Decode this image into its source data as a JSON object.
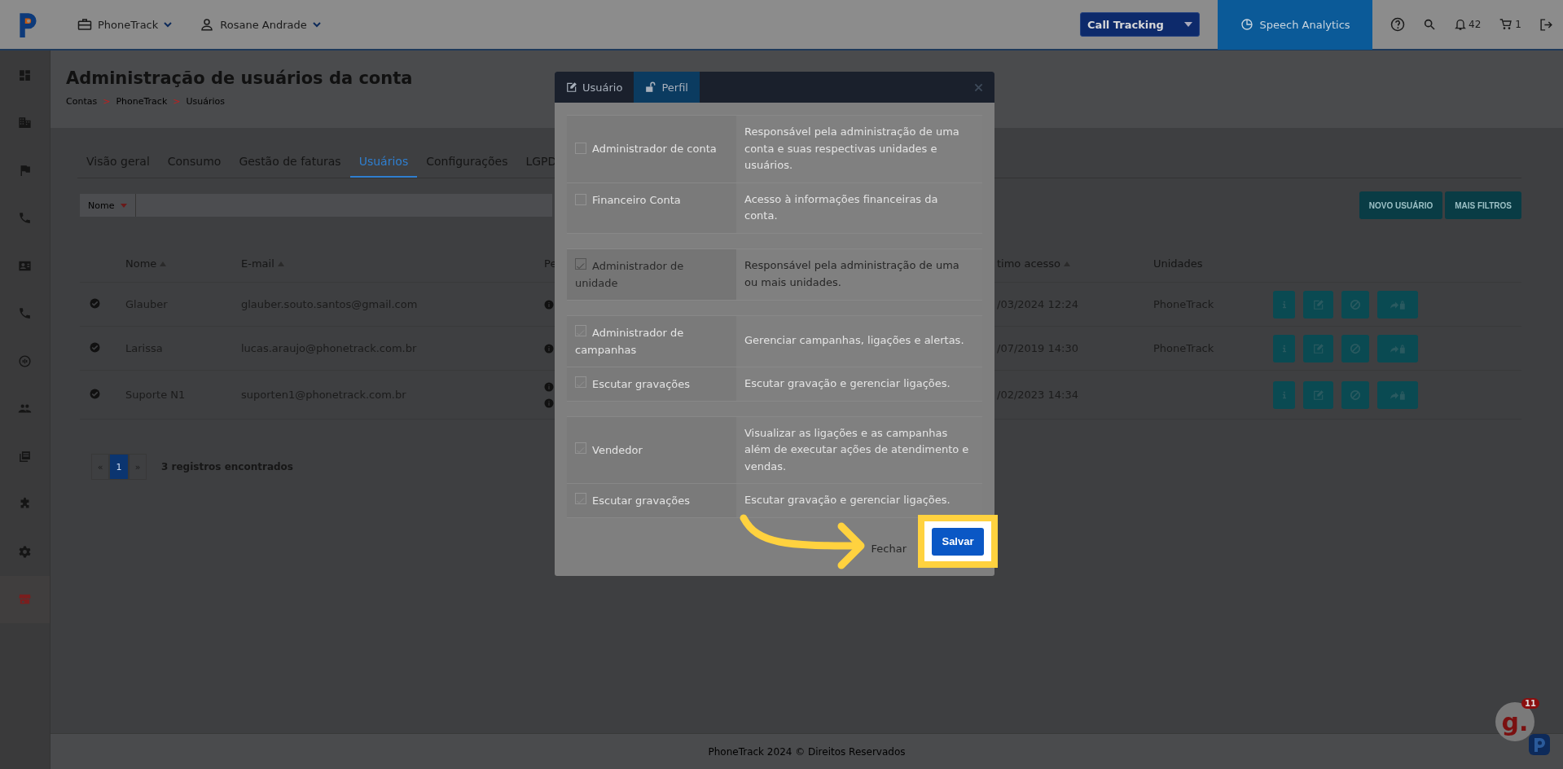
{
  "topbar": {
    "account_menu": "PhoneTrack",
    "user_menu": "Rosane Andrade",
    "product_select": "Call Tracking",
    "speech_analytics": "Speech Analytics",
    "notifications_count": "42",
    "cart_count": "1"
  },
  "sidebar": {
    "items": [
      {
        "kind": "dashboard",
        "selected": false
      },
      {
        "kind": "building",
        "selected": false
      },
      {
        "kind": "flag",
        "selected": false
      },
      {
        "kind": "phone",
        "selected": false
      },
      {
        "kind": "contact",
        "selected": false
      },
      {
        "kind": "phone",
        "selected": false
      },
      {
        "kind": "gauge",
        "selected": false
      },
      {
        "kind": "people",
        "selected": false
      },
      {
        "kind": "list",
        "selected": false
      },
      {
        "kind": "puzzle",
        "selected": false
      },
      {
        "kind": "gear",
        "selected": false
      },
      {
        "kind": "store",
        "selected": true
      }
    ]
  },
  "page": {
    "title": "Administração de usuários da conta",
    "breadcrumb": [
      {
        "label": "Contas",
        "separator": ">"
      },
      {
        "label": "PhoneTrack",
        "separator": ">"
      },
      {
        "label": "Usuários"
      }
    ],
    "tabs": [
      {
        "label": "Visão geral",
        "selected": false
      },
      {
        "label": "Consumo",
        "selected": false
      },
      {
        "label": "Gestão de faturas",
        "selected": false
      },
      {
        "label": "Usuários",
        "selected": true
      },
      {
        "label": "Configurações",
        "selected": false
      },
      {
        "label": "LGPD",
        "selected": false
      }
    ],
    "filter": {
      "field": "Nome"
    },
    "buttons": [
      "NOVO USUÁRIO",
      "MAIS FILTROS"
    ],
    "table": {
      "columns": [
        {
          "label": "Nome",
          "sortable": true
        },
        {
          "label": "E-mail",
          "sortable": true
        },
        {
          "label": "Pe",
          "sortable": false
        },
        {
          "label": "timo acesso",
          "sortable": true
        },
        {
          "label": "Unidades",
          "sortable": false
        }
      ],
      "row_actions": [
        {
          "kind": "info"
        },
        {
          "kind": "edit"
        },
        {
          "kind": "block"
        },
        {
          "kind": "transfer"
        }
      ],
      "rows": [
        {
          "active": true,
          "name": "Glauber",
          "email": "glauber.souto.santos@gmail.com",
          "profile_icons": [
            {
              "kind": "info"
            }
          ],
          "last_access": "/03/2024 12:24",
          "units": "PhoneTrack"
        },
        {
          "active": true,
          "name": "Larissa",
          "email": "lucas.araujo@phonetrack.com.br",
          "profile_icons": [
            {
              "kind": "info"
            }
          ],
          "last_access": "/07/2019 14:30",
          "units": "PhoneTrack"
        },
        {
          "active": true,
          "name": "Suporte N1",
          "email": "suporten1@phonetrack.com.br",
          "profile_icons": [
            {
              "kind": "info"
            },
            {
              "kind": "info"
            }
          ],
          "last_access": "/02/2023 14:34"
        }
      ]
    },
    "pagination": {
      "prev": "«",
      "pages": [
        {
          "label": "1",
          "selected": true
        }
      ],
      "next": "»",
      "summary": "3 registros encontrados"
    }
  },
  "modal": {
    "tabs": [
      {
        "label": "Usuário",
        "kind": "edit",
        "selected": false
      },
      {
        "label": "Perfil",
        "kind": "unlock",
        "selected": true
      }
    ],
    "role_groups": [
      {
        "roles": [
          {
            "label": "Administrador de conta",
            "description": "Responsável pela administração de uma conta e suas respectivas unidades e usuários.",
            "checked": false,
            "disabled": true
          },
          {
            "label": "Financeiro Conta",
            "description": "Acesso à informações financeiras da conta.",
            "checked": false,
            "disabled": true
          }
        ]
      },
      {
        "roles": [
          {
            "label": "Administrador de unidade",
            "description": "Responsável pela administração de uma ou mais unidades.",
            "checked": true,
            "disabled": false
          }
        ]
      },
      {
        "roles": [
          {
            "label": "Administrador de campanhas",
            "description": "Gerenciar campanhas, ligações e alertas.",
            "checked": true,
            "disabled": true
          },
          {
            "label": "Escutar gravações",
            "description": "Escutar gravação e gerenciar ligações.",
            "checked": true,
            "disabled": true
          }
        ]
      },
      {
        "roles": [
          {
            "label": "Vendedor",
            "description": "Visualizar as ligações e as campanhas além de executar ações de atendimento e vendas.",
            "checked": true,
            "disabled": true
          },
          {
            "label": "Escutar gravações",
            "description": "Escutar gravação e gerenciar ligações.",
            "checked": true,
            "disabled": true
          }
        ]
      }
    ],
    "close_button": "Fechar",
    "save_button": "Salvar",
    "save_highlighted": true
  },
  "footer": {
    "text": "PhoneTrack 2024 © Direitos Reservados"
  },
  "help_widget": {
    "label": "g.",
    "badge": "11"
  }
}
